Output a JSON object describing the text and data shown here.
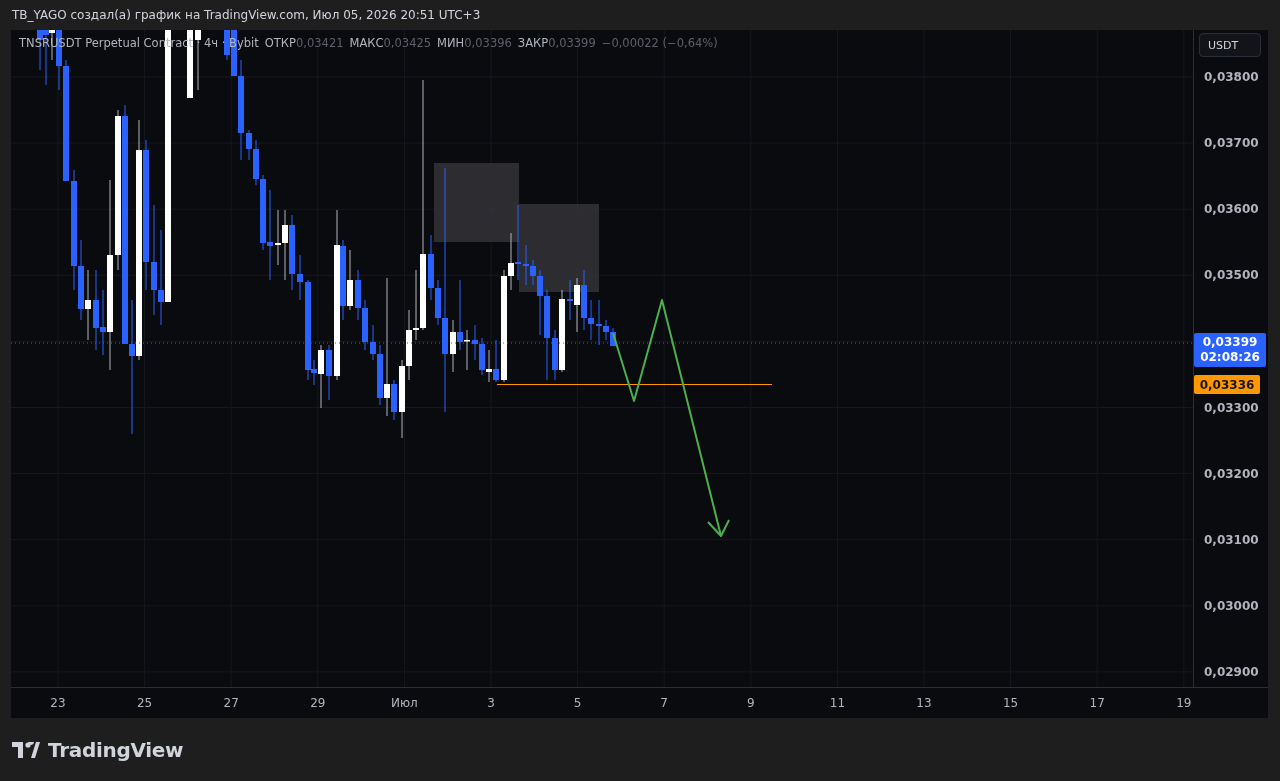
{
  "header": {
    "attribution": "TB_YAGO создал(а) график на TradingView.com, Июл 05, 2026 20:51 UTC+3"
  },
  "legend": {
    "title": "TNSRUSDT Perpetual Contract · 4ч · Bybit",
    "ohlc": [
      {
        "label": "ОТКР",
        "value": "0,03421"
      },
      {
        "label": "МАКС",
        "value": "0,03425"
      },
      {
        "label": "МИН",
        "value": "0,03396"
      },
      {
        "label": "ЗАКР",
        "value": "0,03399"
      }
    ],
    "change": "−0,00022 (−0,64%)"
  },
  "price_axis": {
    "currency": "USDT",
    "ticks": [
      "0,03800",
      "0,03700",
      "0,03600",
      "0,03500",
      "0,03300",
      "0,03200",
      "0,03100",
      "0,03000",
      "0,02900"
    ],
    "last_price": {
      "price": "0,03399",
      "countdown": "02:08:26"
    },
    "level_label": "0,03336"
  },
  "time_axis": {
    "labels": [
      "23",
      "25",
      "27",
      "29",
      "Июл",
      "3",
      "5",
      "7",
      "9",
      "11",
      "13",
      "15",
      "17",
      "19"
    ]
  },
  "footer": {
    "logo": "TradingView"
  }
}
